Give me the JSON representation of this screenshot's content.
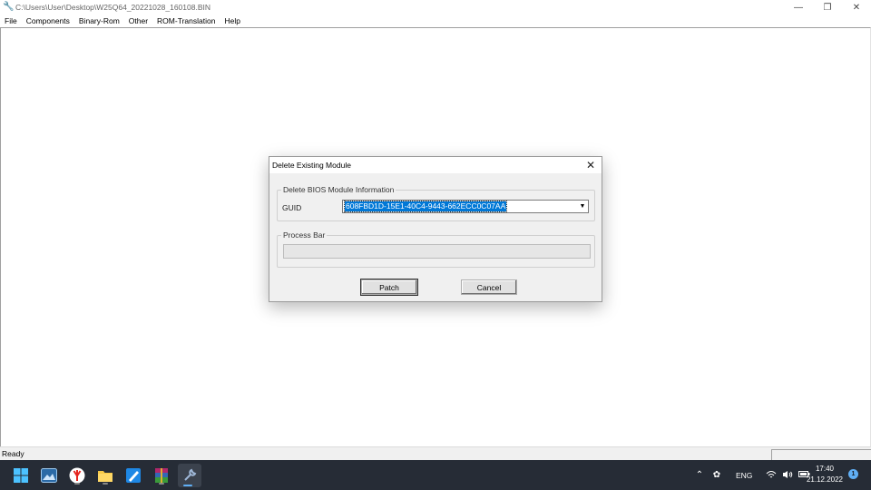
{
  "window": {
    "title": "C:\\Users\\User\\Desktop\\W25Q64_20221028_160108.BIN"
  },
  "menu": {
    "items": [
      "File",
      "Components",
      "Binary-Rom",
      "Other",
      "ROM-Translation",
      "Help"
    ]
  },
  "dialog": {
    "title": "Delete Existing Module",
    "group1_legend": "Delete BIOS Module Information",
    "guid_label": "GUID",
    "guid_value": "608FBD1D-15E1-40C4-9443-662ECC0C07AA",
    "group2_legend": "Process Bar",
    "progress": 0,
    "patch_label": "Patch",
    "cancel_label": "Cancel"
  },
  "status": {
    "text": "Ready"
  },
  "taskbar": {
    "apps": [
      "start-icon",
      "photos-icon",
      "yandex-browser-icon",
      "file-explorer-icon",
      "paint-icon",
      "winrar-icon",
      "tool-icon"
    ],
    "language": "ENG",
    "time": "17:40",
    "date": "21.12.2022",
    "notifications": "1"
  },
  "colors": {
    "accent": "#0078d7",
    "taskbar": "#262c36",
    "dialog_bg": "#f0f0f0"
  }
}
